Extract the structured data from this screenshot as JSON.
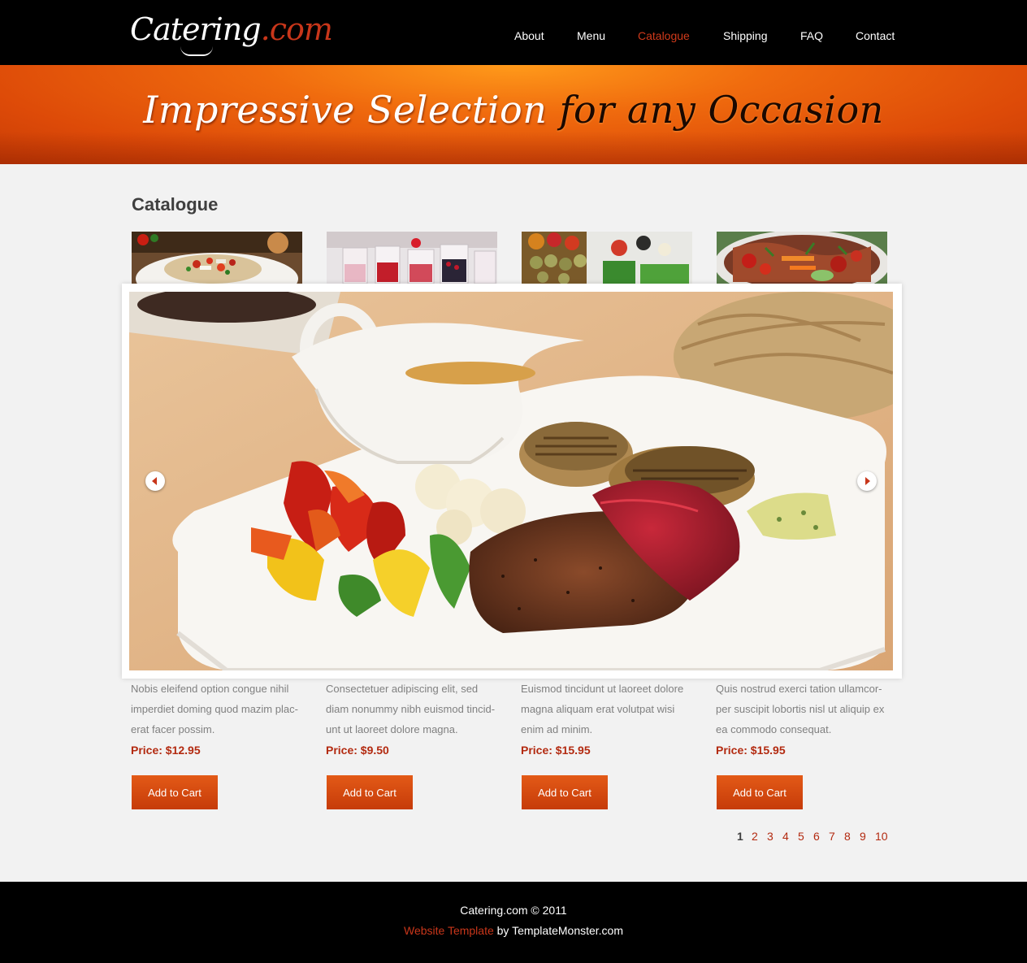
{
  "brand": {
    "name": "Catering",
    "tld": ".com"
  },
  "nav": {
    "items": [
      {
        "label": "About",
        "active": false
      },
      {
        "label": "Menu",
        "active": false
      },
      {
        "label": "Catalogue",
        "active": true
      },
      {
        "label": "Shipping",
        "active": false
      },
      {
        "label": "FAQ",
        "active": false
      },
      {
        "label": "Contact",
        "active": false
      }
    ]
  },
  "banner": {
    "light": "Impressive Selection",
    "dark": "for any Occasion"
  },
  "main": {
    "title": "Catalogue",
    "items": [
      {
        "image": "salad-plate-photo",
        "description": "Nobis eleifend option congue nihil imperdiet doming quod mazim plac-erat facer possim.",
        "price": "Price: $12.95",
        "button": "Add to Cart"
      },
      {
        "image": "dessert-glasses-photo",
        "description": "Consectetuer adipiscing elit, sed diam nonummy nibh euismod tincid-unt ut laoreet dolore magna.",
        "price": "Price: $9.50",
        "button": "Add to Cart"
      },
      {
        "image": "canape-skewers-photo",
        "description": "Euismod tincidunt ut laoreet dolore magna aliquam erat volutpat wisi enim ad minim.",
        "price": "Price: $15.95",
        "button": "Add to Cart"
      },
      {
        "image": "vegetable-salad-photo",
        "description": "Quis nostrud exerci tation ullamcor-per suscipit lobortis nisl ut aliquip ex ea commodo consequat.",
        "price": "Price: $15.95",
        "button": "Add to Cart"
      }
    ],
    "slider": {
      "image": "steak-with-vegetables-photo",
      "prev_icon": "arrow-left-icon",
      "next_icon": "arrow-right-icon"
    },
    "pagination": {
      "current": "1",
      "pages": [
        "1",
        "2",
        "3",
        "4",
        "5",
        "6",
        "7",
        "8",
        "9",
        "10"
      ]
    }
  },
  "footer": {
    "copyright": "Catering.com © 2011",
    "link": "Website Template",
    "by": " by TemplateMonster.com"
  },
  "colors": {
    "accent": "#c8361a",
    "banner": "#e8590c",
    "header": "#000000",
    "background": "#f2f2f2"
  }
}
